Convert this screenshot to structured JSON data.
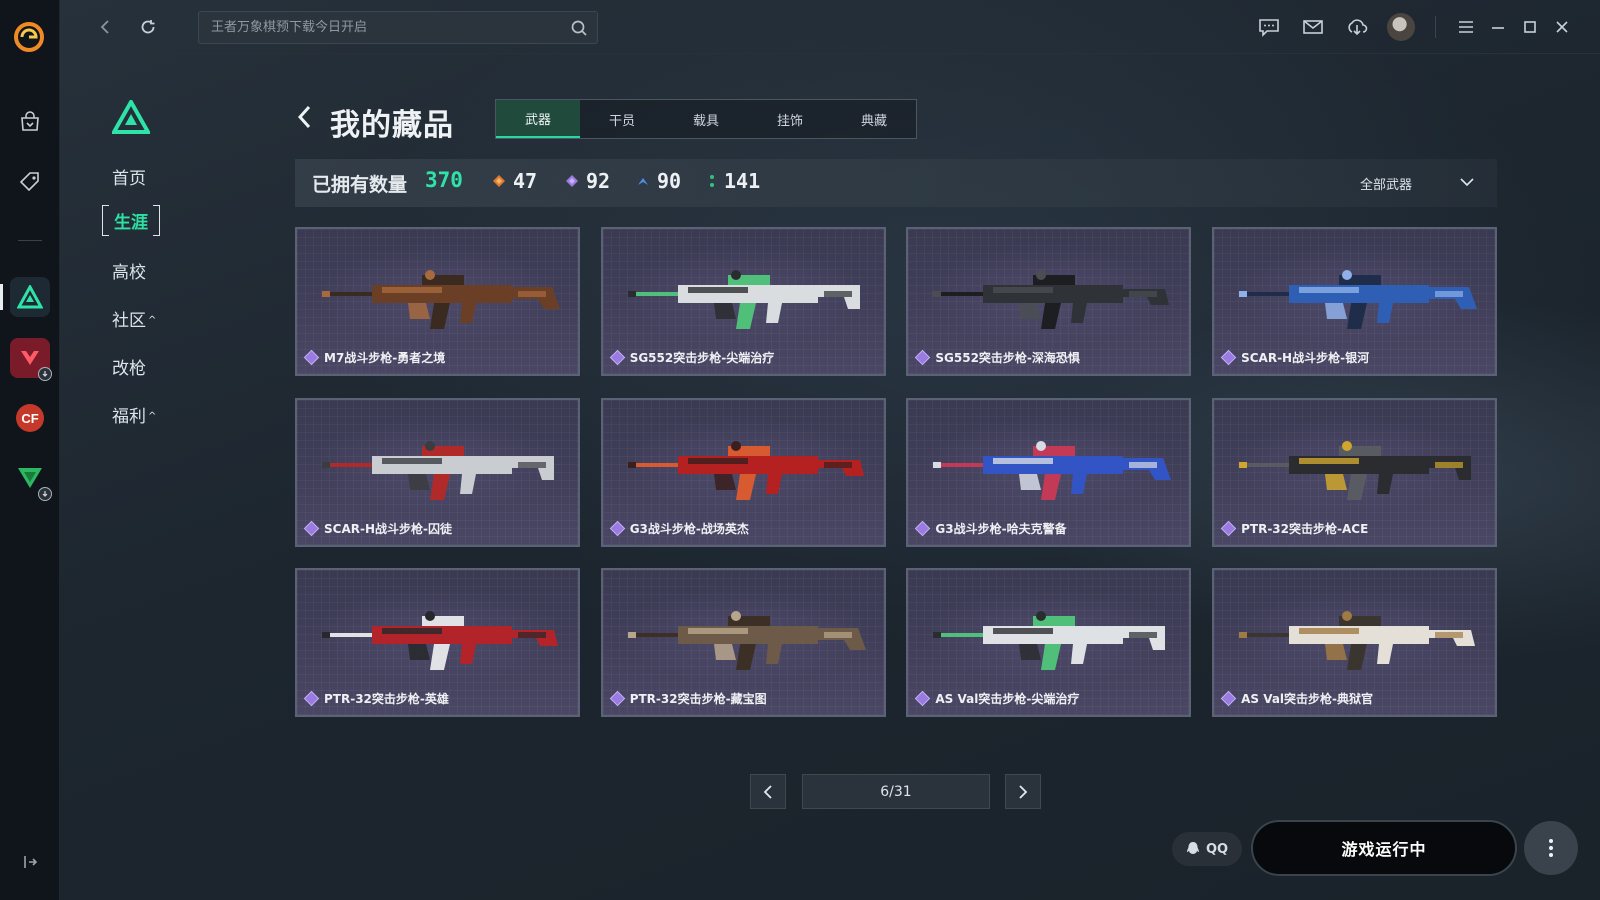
{
  "topbar": {
    "search_placeholder": "王者万象棋预下载今日开启"
  },
  "side_nav": {
    "items": [
      {
        "label": "首页"
      },
      {
        "label": "生涯"
      },
      {
        "label": "高校"
      },
      {
        "label": "社区"
      },
      {
        "label": "改枪"
      },
      {
        "label": "福利"
      }
    ],
    "caret": "^"
  },
  "page": {
    "title": "我的藏品",
    "tabs": [
      "武器",
      "干员",
      "载具",
      "挂饰",
      "典藏"
    ]
  },
  "stats": {
    "owned_label": "已拥有数量",
    "owned_total": "370",
    "tiers": [
      {
        "icon": "orange-diamond-icon",
        "color": "#e07a2e",
        "value": "47"
      },
      {
        "icon": "purple-diamond-icon",
        "color": "#9a7be0",
        "value": "92"
      },
      {
        "icon": "blue-arrow-icon",
        "color": "#4d8fe6",
        "value": "90"
      },
      {
        "icon": "green-dots-icon",
        "color": "#2ec27e",
        "value": "141"
      }
    ],
    "filter_label": "全部武器"
  },
  "weapons": [
    {
      "name": "M7战斗步枪-勇者之境",
      "palette": [
        "#6b3f25",
        "#a66a3e",
        "#3a2a20"
      ]
    },
    {
      "name": "SG552突击步枪-尖端治疗",
      "palette": [
        "#d9dde0",
        "#2a2d30",
        "#4fbf7a"
      ]
    },
    {
      "name": "SG552突击步枪-深海恐惧",
      "palette": [
        "#2f3236",
        "#4a4e53",
        "#1c1e21"
      ]
    },
    {
      "name": "SCAR-H战斗步枪-银河",
      "palette": [
        "#2f5fb5",
        "#8fb0e8",
        "#1f2d4a"
      ]
    },
    {
      "name": "SCAR-H战斗步枪-囚徒",
      "palette": [
        "#c9ccd0",
        "#3a3c40",
        "#b02a2a"
      ]
    },
    {
      "name": "G3战斗步枪-战场英杰",
      "palette": [
        "#b52121",
        "#3a1f1f",
        "#d85a30"
      ]
    },
    {
      "name": "G3战斗步枪-哈夫克警备",
      "palette": [
        "#3354c4",
        "#d6dbe6",
        "#c23a55"
      ]
    },
    {
      "name": "PTR-32突击步枪-ACE",
      "palette": [
        "#2a2c30",
        "#cfa72e",
        "#585c62"
      ]
    },
    {
      "name": "PTR-32突击步枪-英雄",
      "palette": [
        "#b3232a",
        "#26282c",
        "#e0e2e6"
      ]
    },
    {
      "name": "PTR-32突击步枪-藏宝图",
      "palette": [
        "#6e5a48",
        "#b8a68c",
        "#3c2f26"
      ]
    },
    {
      "name": "AS Val突击步枪-尖端治疗",
      "palette": [
        "#dfe2e5",
        "#2a2d30",
        "#4fbf7a"
      ]
    },
    {
      "name": "AS Val突击步枪-典狱官",
      "palette": [
        "#e4e0d8",
        "#a07a45",
        "#3b3530"
      ]
    }
  ],
  "pager": {
    "text": "6/31"
  },
  "footer": {
    "qq_label": "QQ",
    "launch_label": "游戏运行中"
  },
  "colors": {
    "accent": "#2fe3a8",
    "card_border": "#5b6275",
    "rarity_gem": "#9a7be0"
  }
}
